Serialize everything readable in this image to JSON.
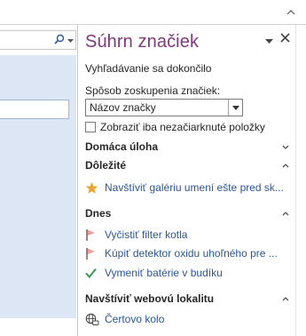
{
  "ribbon": {
    "toggle_icon": "chevron-up-icon"
  },
  "left_pane": {
    "search_icon": "search-icon"
  },
  "pane": {
    "title": "Súhrn značiek",
    "status": "Vyhľadávanie sa dokončilo",
    "group_label": "Spôsob zoskupenia značiek:",
    "group_value": "Názov značky",
    "checkbox_label": "Zobraziť iba nezačiarknuté položky",
    "checkbox_checked": false
  },
  "sections": [
    {
      "title": "Domáca úloha",
      "expanded": false,
      "items": []
    },
    {
      "title": "Dôležité",
      "expanded": true,
      "items": [
        {
          "icon": "star-icon",
          "text": "Navštíviť galériu umení ešte pred sk..."
        }
      ]
    },
    {
      "title": "Dnes",
      "expanded": true,
      "items": [
        {
          "icon": "flag-icon",
          "text": "Vyčistiť filter kotla"
        },
        {
          "icon": "flag-icon",
          "text": "Kúpiť detektor oxidu uhoľného pre ..."
        },
        {
          "icon": "checkmark-icon",
          "text": "Vymeniť batérie v budíku"
        }
      ]
    },
    {
      "title": "Navštíviť webovú lokalitu",
      "expanded": true,
      "items": [
        {
          "icon": "globe-link-icon",
          "text": "Čertovo kolo"
        }
      ]
    }
  ],
  "colors": {
    "title": "#80397b",
    "link": "#2b579a",
    "band": "#dce6f4",
    "star": "#e8a73a",
    "flag": "#c0504d",
    "check": "#3c9a5f"
  }
}
